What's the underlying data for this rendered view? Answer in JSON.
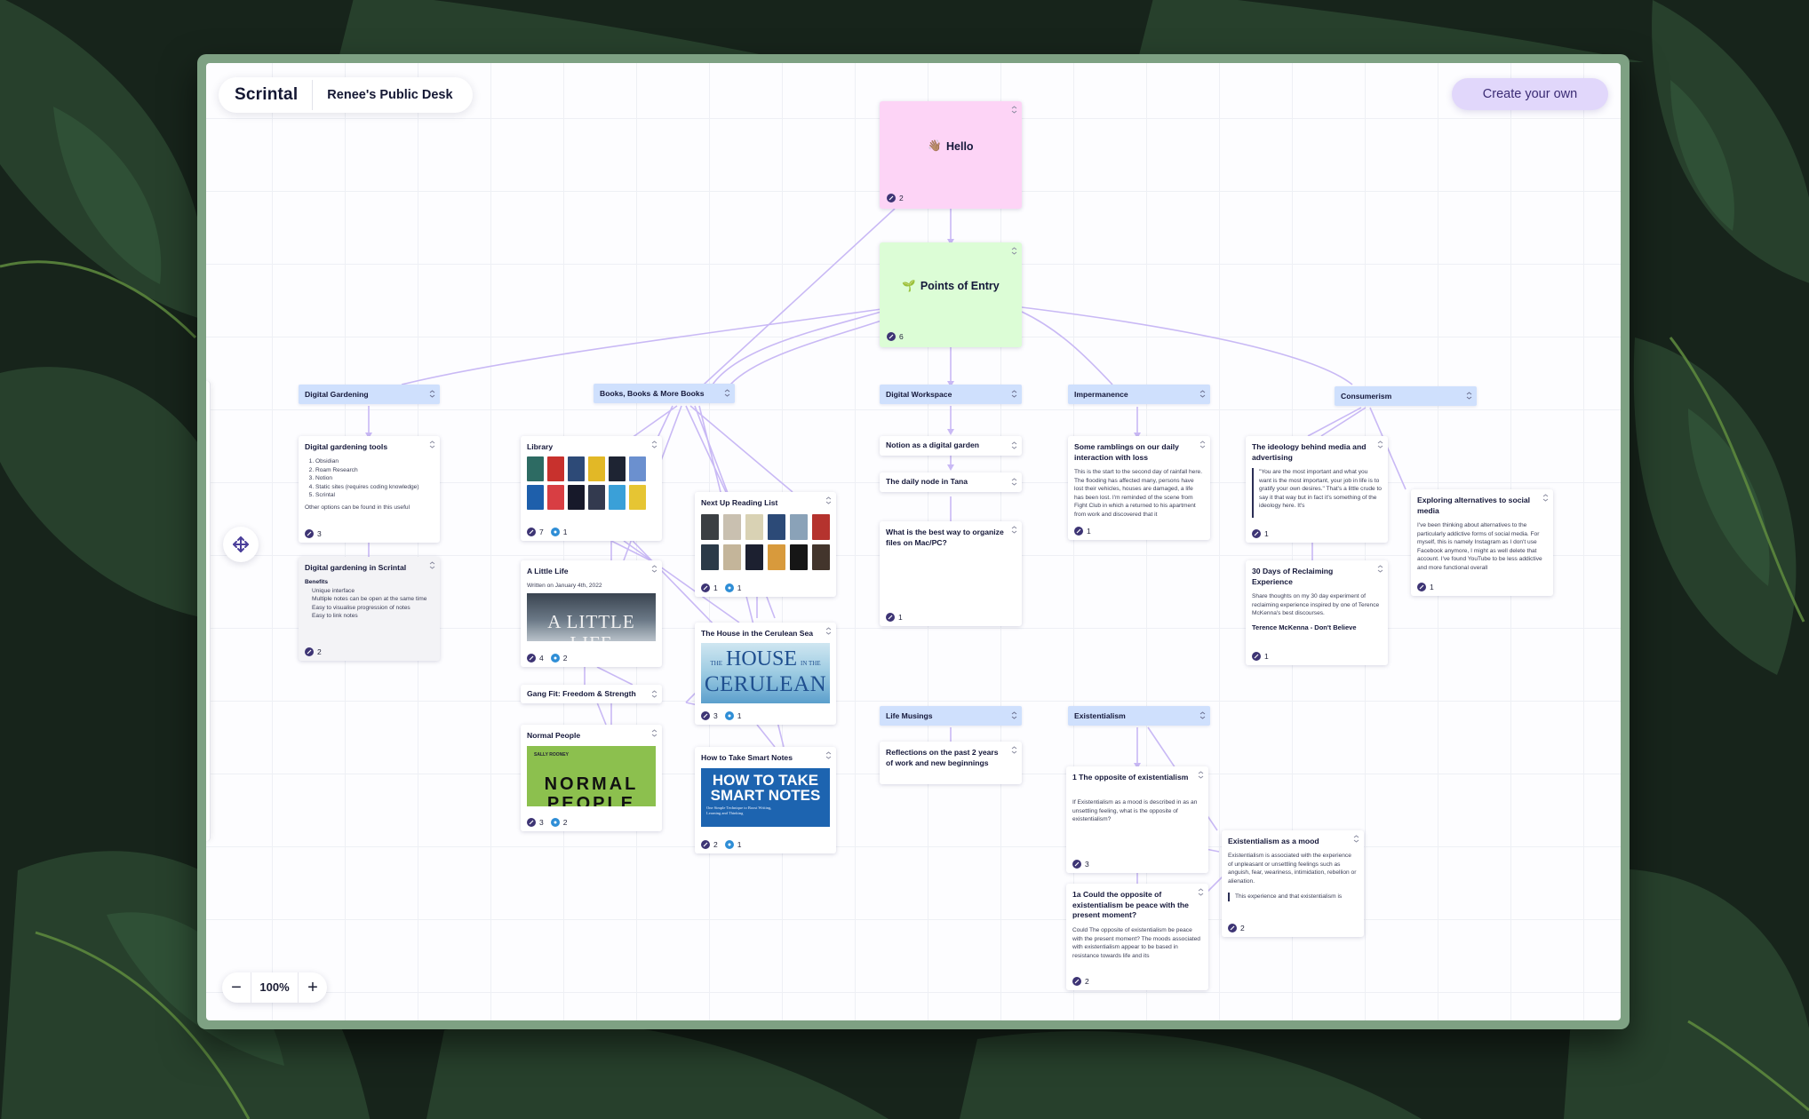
{
  "app": {
    "logo": "Scrintal",
    "desk_name": "Renee's Public Desk",
    "create_button": "Create your own",
    "zoom": {
      "minus": "−",
      "level": "100%",
      "plus": "+"
    }
  },
  "colors": {
    "accent": "#e1d7fb",
    "hello_card": "#fdd4f6",
    "points_card": "#dcfdd6",
    "tag": "#cfe0fd",
    "connection": "#c9b9f5",
    "frame": "#7ea183"
  },
  "cards": {
    "hello": {
      "emoji": "👋🏽",
      "title": "Hello",
      "links": "2"
    },
    "points": {
      "emoji": "🌱",
      "title": "Points of Entry",
      "links": "6"
    },
    "tag_digital_gardening": "Digital Gardening",
    "tag_books": "Books, Books & More Books",
    "tag_digital_workspace": "Digital Workspace",
    "tag_impermanence": "Impermanence",
    "tag_consumerism": "Consumerism",
    "tag_life_musings": "Life Musings",
    "tag_existentialism": "Existentialism",
    "dg_tools": {
      "title": "Digital gardening tools",
      "items": [
        "Obsidian",
        "Roam Research",
        "Notion",
        "Static sites (requires coding knowledge)",
        "Scrintal"
      ],
      "more": "Other options can be found in this useful",
      "links": "3"
    },
    "dg_scrintal": {
      "title": "Digital gardening in Scrintal",
      "heading": "Benefits",
      "items": [
        "Unique interface",
        "Multiple notes can be open at the same time",
        "Easy to visualise progression of notes",
        "Easy to link notes"
      ],
      "links": "2"
    },
    "library": {
      "title": "Library",
      "links": "7",
      "refs": "1"
    },
    "next_up": {
      "title": "Next Up Reading List",
      "links": "1",
      "refs": "1"
    },
    "little_life": {
      "title": "A Little Life",
      "written": "Written on January 4th, 2022",
      "cover_text": "A LITTLE LIFE",
      "links": "4",
      "refs": "2"
    },
    "house_cerulean": {
      "title": "The House in the Cerulean Sea",
      "cover_small": "THE",
      "cover_big": "HOUSE",
      "cover_small2": "IN THE",
      "cover_line2": "CERULEAN",
      "links": "3",
      "refs": "1"
    },
    "gang_fit": {
      "title": "Gang Fit: Freedom & Strength"
    },
    "normal_people": {
      "title": "Normal People",
      "cover_small": "SALLY ROONEY",
      "cover_text": "NORMAL PEOPLE",
      "links": "3",
      "refs": "2"
    },
    "smart_notes": {
      "title": "How to Take Smart Notes",
      "cover_line1": "HOW TO TAKE",
      "cover_line2": "SMART NOTES",
      "cover_sub": "One Simple Technique to Boost Writing, Learning and Thinking",
      "links": "2",
      "refs": "1"
    },
    "notion_garden": {
      "title": "Notion as a digital garden"
    },
    "tana_node": {
      "title": "The daily node in Tana"
    },
    "organize_files": {
      "title": "What is the best way to organize files on Mac/PC?",
      "links": "1"
    },
    "ramblings": {
      "title": "Some ramblings on our daily interaction with loss",
      "body": "This is the start to the second day of rainfall here. The flooding has affected many, persons have lost their vehicles, houses are damaged, a life has been lost. I'm reminded of the scene from Fight Club in which a returned to his apartment from work and discovered that it",
      "links": "1"
    },
    "ideology": {
      "title": "The ideology behind media and advertising",
      "body": "\"You are the most important and what you want is the most important, your job in life is to gratify your own desires.\" That's a little crude to say it that way but in fact it's something of the ideology here. It's",
      "links": "1"
    },
    "social_media": {
      "title": "Exploring alternatives to social media",
      "body": "I've been thinking about alternatives to the particularly addictive forms of social media. For myself, this is namely Instagram as I don't use Facebook anymore, I might as well delete that account. I've found YouTube to be less addictive and more functional overall",
      "links": "1"
    },
    "thirty_days": {
      "title": "30 Days of Reclaiming Experience",
      "body": "Share thoughts on my 30 day experiment of reclaiming experience inspired by one of Terence McKenna's best discourses.",
      "sub": "Terence McKenna - Don't Believe",
      "links": "1"
    },
    "reflections": {
      "title": "Reflections on the past 2 years of work and new beginnings"
    },
    "opposite": {
      "title": "1 The opposite of existentialism",
      "body": "If Existentialism as a mood is described in as an unsettling feeling, what is the opposite of existentialism?",
      "links": "3"
    },
    "as_mood": {
      "title": "Existentialism as a mood",
      "body": "Existentialism is associated with the experience of unpleasant or unsettling feelings such as anguish, fear, weariness, intimidation, rebellion or alienation.",
      "quote": "This experience and that existentialism is",
      "links": "2"
    },
    "peace": {
      "title": "1a Could the opposite of existentialism be peace with the present moment?",
      "body": "Could The opposite of existentialism be peace with the present moment? The moods associated with existentialism appear to be based in resistance towards life and its",
      "links": "2"
    }
  }
}
